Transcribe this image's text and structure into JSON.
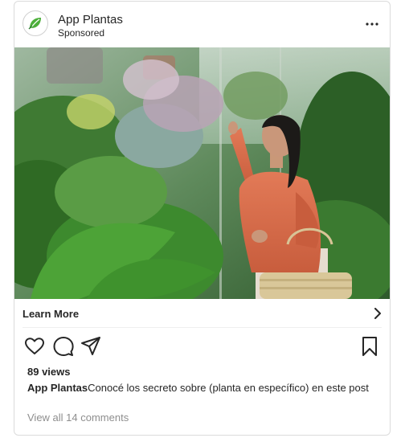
{
  "post": {
    "account_name": "App Plantas",
    "sponsored_label": "Sponsored",
    "more_icon": "more-horizontal-icon",
    "photo_alt": "Woman looking at plants in a greenhouse"
  },
  "cta": {
    "label": "Learn More",
    "icon": "chevron-right-icon"
  },
  "actions": {
    "like_icon": "heart-icon",
    "comment_icon": "comment-icon",
    "share_icon": "send-icon",
    "save_icon": "bookmark-icon"
  },
  "stats": {
    "views": "89 views"
  },
  "caption": {
    "account": "App Plantas",
    "text": "Conocé los secreto sobre (planta en específico) en este post"
  },
  "comments": {
    "link": "View all 14 comments"
  },
  "colors": {
    "text": "#262626",
    "muted": "#8e8e8e",
    "border": "#dbdbdb",
    "logo_green": "#4caf3a"
  }
}
